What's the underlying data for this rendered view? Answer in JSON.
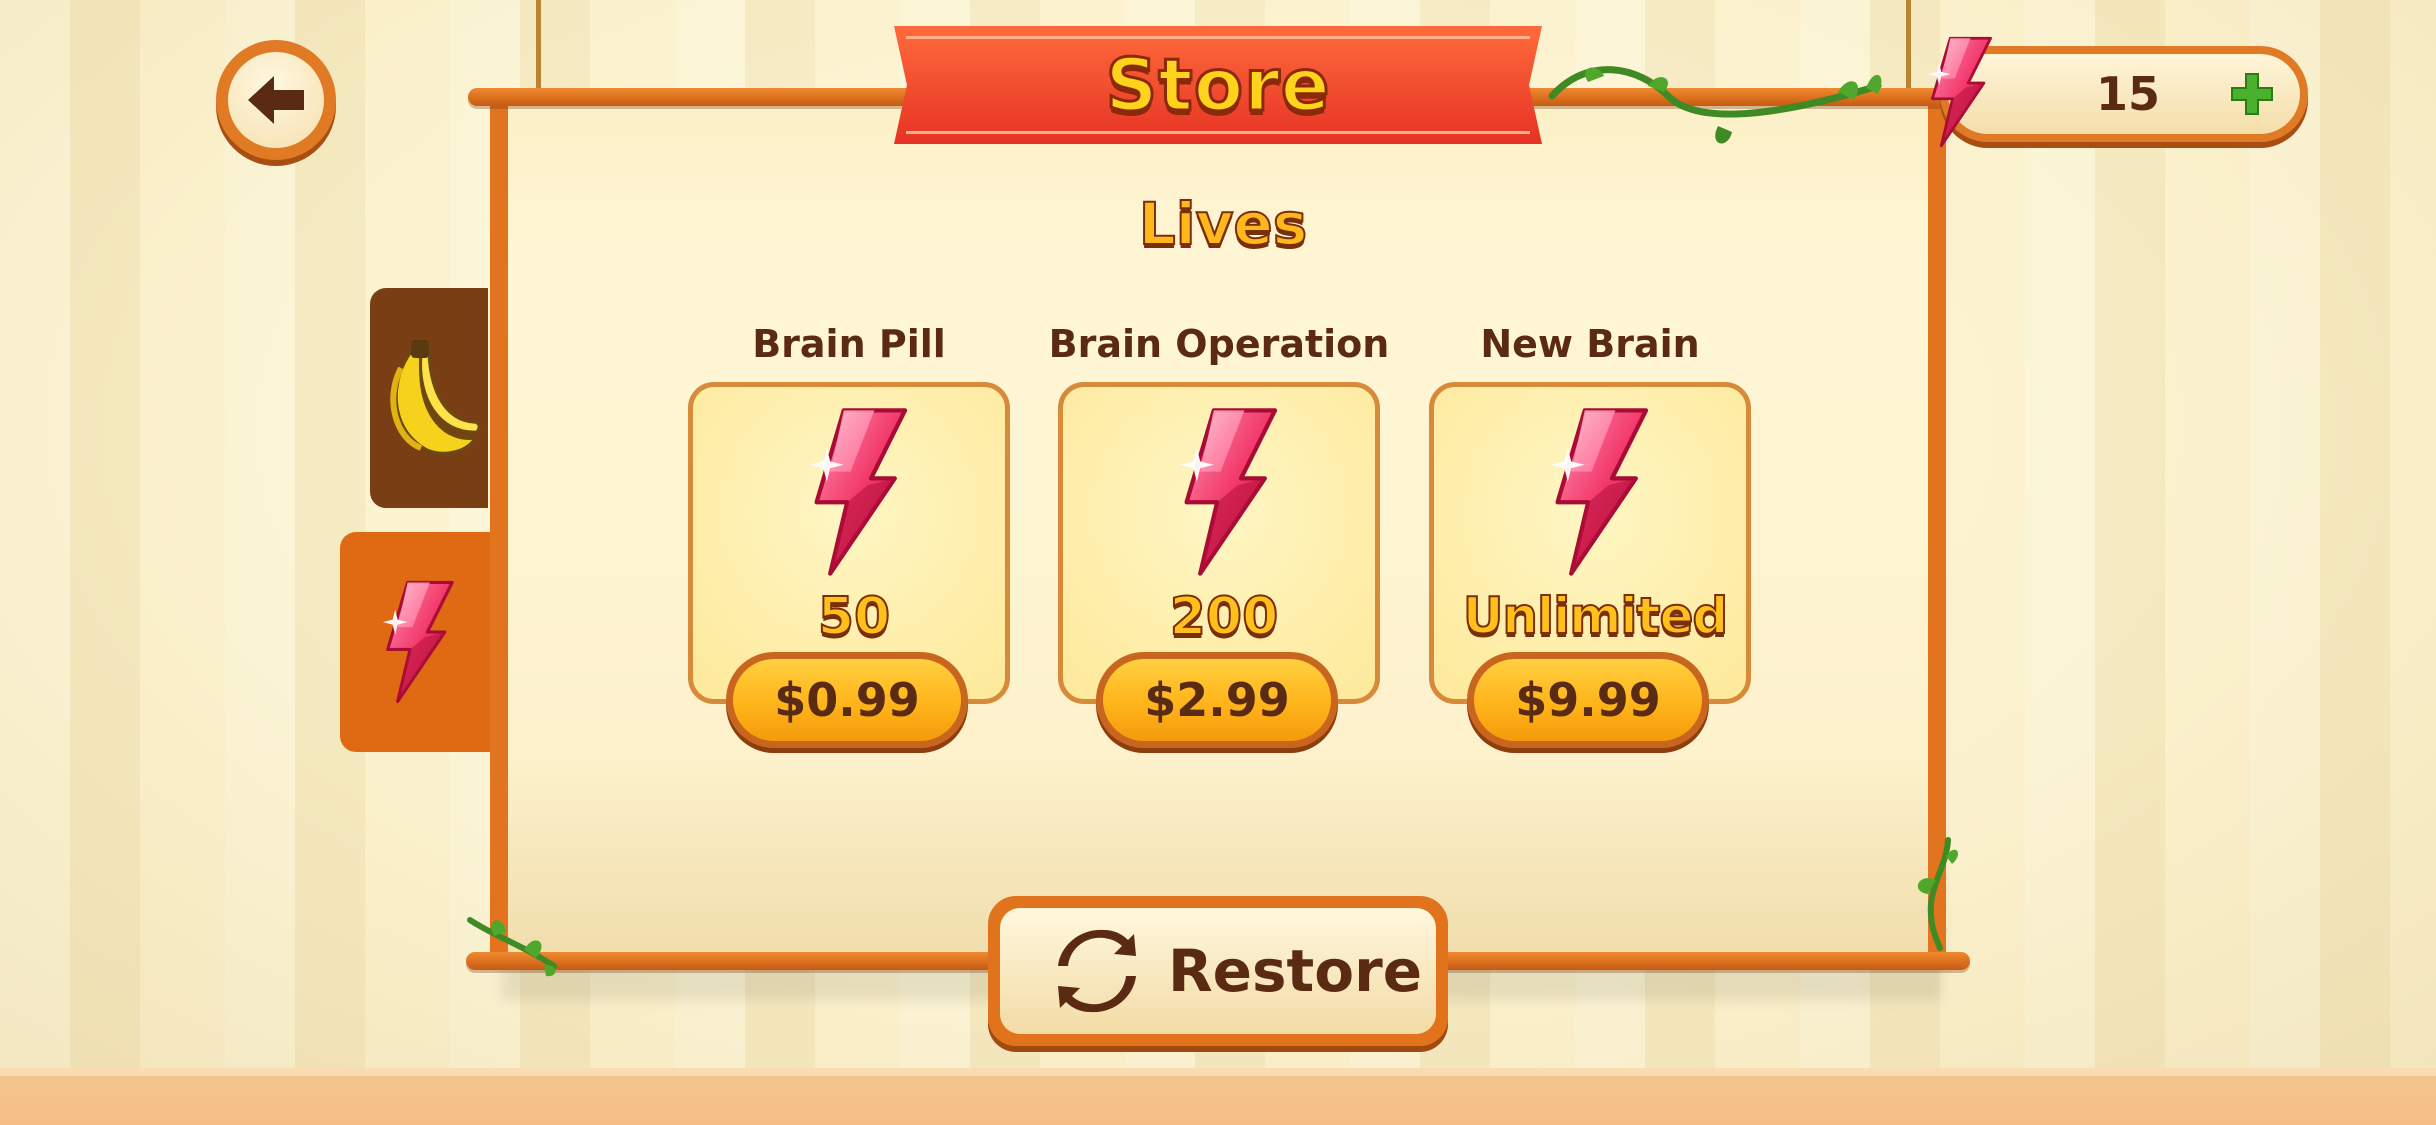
{
  "header": {
    "title": "Store",
    "back_icon": "back-arrow-icon",
    "currency": {
      "icon": "energy-gem-icon",
      "value": "15",
      "add_icon": "plus-icon"
    }
  },
  "tabs": [
    {
      "icon": "banana-icon",
      "selected": false
    },
    {
      "icon": "energy-gem-icon",
      "selected": true
    }
  ],
  "section": {
    "title": "Lives"
  },
  "products": [
    {
      "name": "Brain Pill",
      "amount": "50",
      "price": "$0.99",
      "icon": "energy-gem-icon"
    },
    {
      "name": "Brain Operation",
      "amount": "200",
      "price": "$2.99",
      "icon": "energy-gem-icon"
    },
    {
      "name": "New Brain",
      "amount": "Unlimited",
      "price": "$9.99",
      "icon": "energy-gem-icon"
    }
  ],
  "restore": {
    "label": "Restore",
    "icon": "refresh-icon"
  },
  "colors": {
    "frame": "#e2731f",
    "banner": "#e63324",
    "title_text": "#ffd21c",
    "text_dark": "#5a2a12",
    "price_button": "#ffb41a",
    "tab_selected": "#e06a14",
    "tab_unselected": "#7a3e14"
  }
}
